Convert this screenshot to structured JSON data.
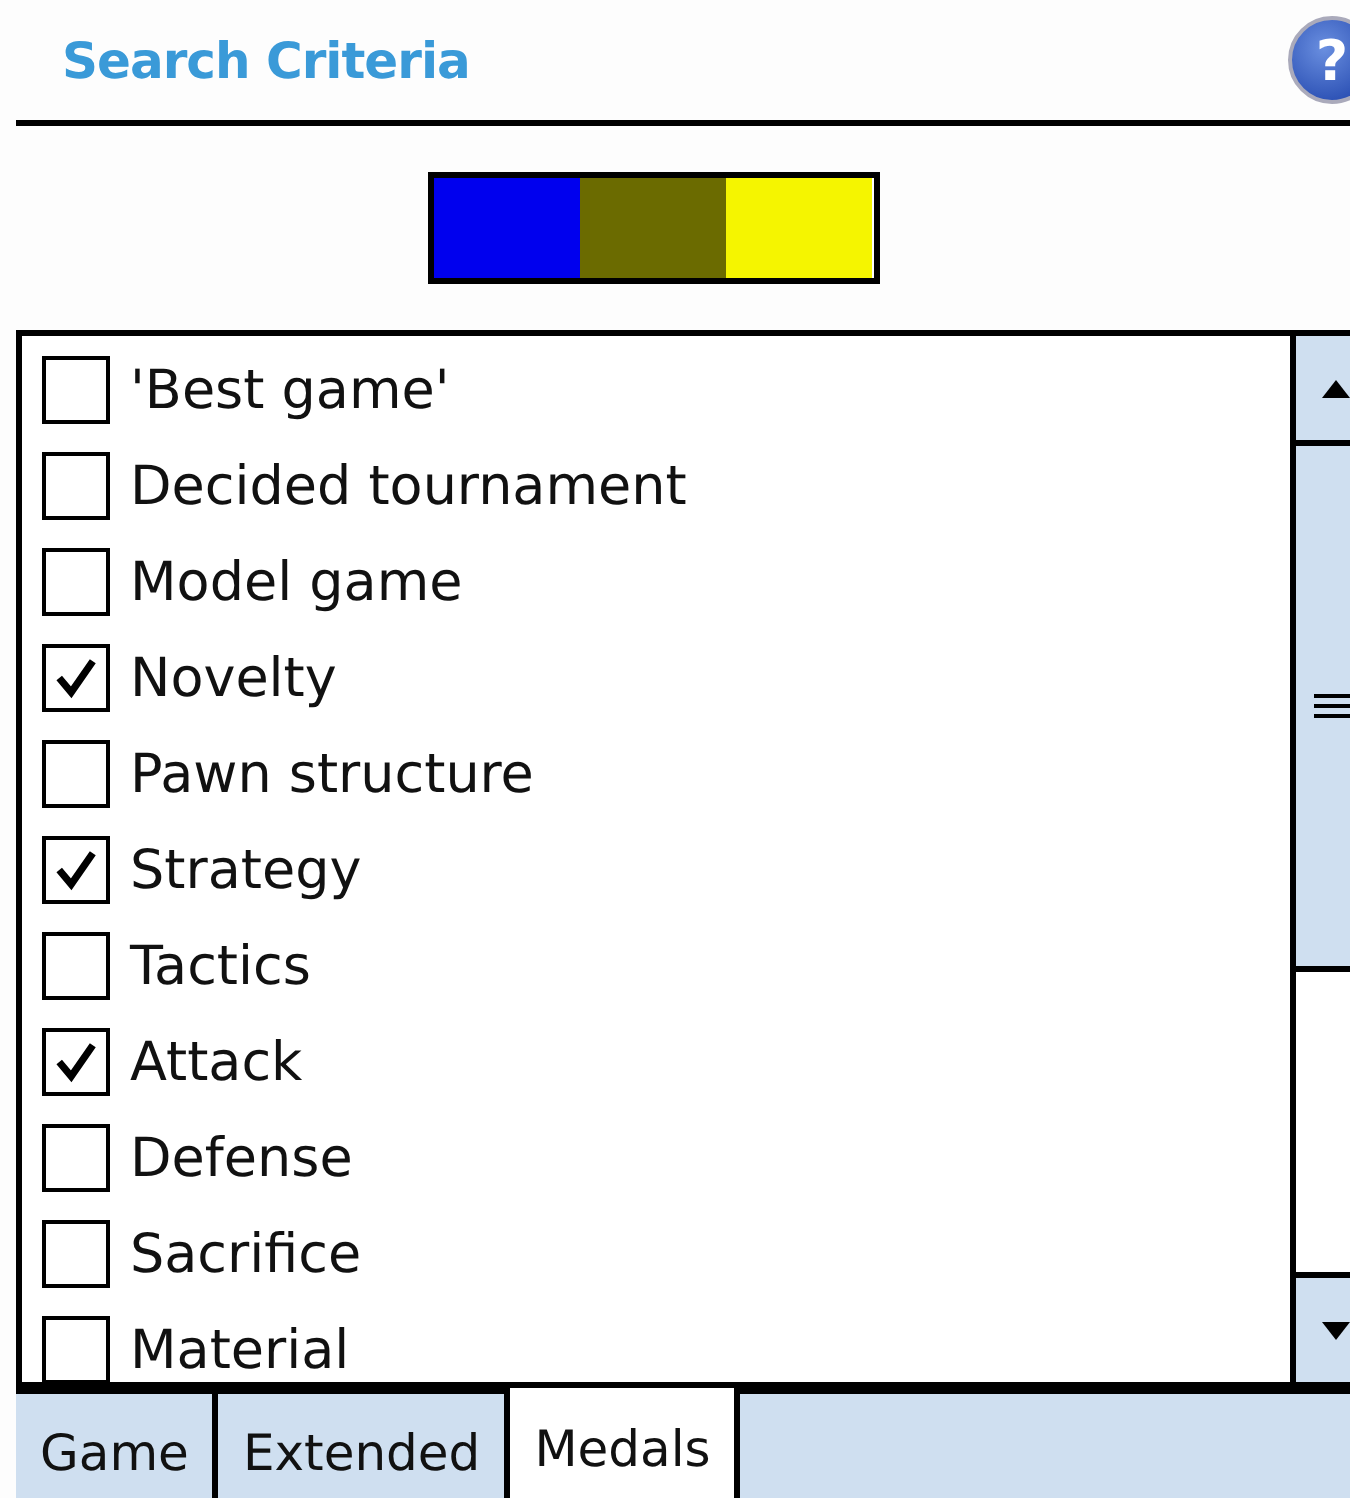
{
  "header": {
    "title": "Search Criteria",
    "help_icon": "?"
  },
  "color_bar": [
    {
      "color": "#0000ee"
    },
    {
      "color": "#6b6b00"
    },
    {
      "color": "#f5f500"
    }
  ],
  "criteria": [
    {
      "label": "'Best game'",
      "checked": false
    },
    {
      "label": "Decided tournament",
      "checked": false
    },
    {
      "label": "Model game",
      "checked": false
    },
    {
      "label": "Novelty",
      "checked": true
    },
    {
      "label": "Pawn structure",
      "checked": false
    },
    {
      "label": "Strategy",
      "checked": true
    },
    {
      "label": "Tactics",
      "checked": false
    },
    {
      "label": "Attack",
      "checked": true
    },
    {
      "label": "Defense",
      "checked": false
    },
    {
      "label": "Sacrifice",
      "checked": false
    },
    {
      "label": "Material",
      "checked": false
    }
  ],
  "tabs": [
    {
      "label": "Game",
      "selected": false
    },
    {
      "label": "Extended",
      "selected": false
    },
    {
      "label": "Medals",
      "selected": true
    }
  ]
}
